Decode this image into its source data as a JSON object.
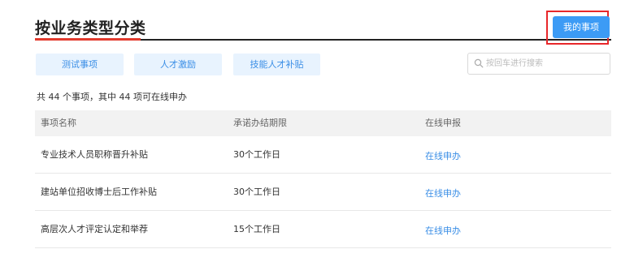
{
  "header": {
    "title": "按业务类型分类",
    "my_items_label": "我的事项"
  },
  "tags": [
    "测试事项",
    "人才激励",
    "技能人才补贴"
  ],
  "search": {
    "placeholder": "按回车进行搜索"
  },
  "summary": "共 44 个事项，其中 44 项可在线申办",
  "table": {
    "columns": [
      "事项名称",
      "承诺办结期限",
      "在线申报"
    ],
    "rows": [
      {
        "name": "专业技术人员职称晋升补贴",
        "deadline": "30个工作日",
        "action": "在线申办"
      },
      {
        "name": "建站单位招收博士后工作补贴",
        "deadline": "30个工作日",
        "action": "在线申办"
      },
      {
        "name": "高层次人才评定认定和举荐",
        "deadline": "15个工作日",
        "action": "在线申办"
      }
    ]
  },
  "colors": {
    "accent_blue": "#3c9bf5",
    "link_blue": "#3a8ee6",
    "highlight_red": "#e8272a",
    "title_accent_red": "#e23b2e"
  }
}
